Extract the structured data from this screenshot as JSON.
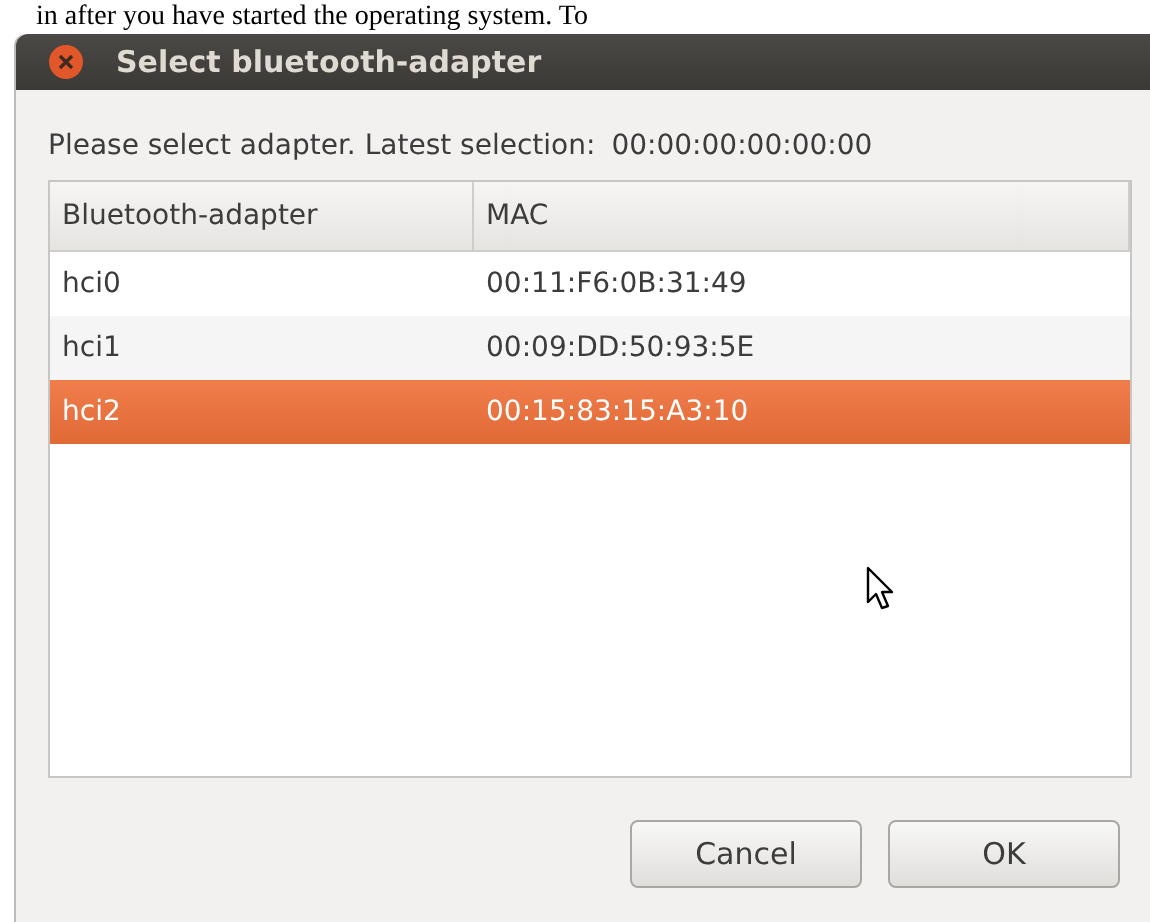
{
  "background_text": "in after you have started the operating system. To",
  "window": {
    "title": "Select bluetooth-adapter"
  },
  "prompt": "Please select adapter. Latest selection:",
  "latest_selection": "00:00:00:00:00:00",
  "table": {
    "columns": [
      "Bluetooth-adapter",
      "MAC"
    ],
    "rows": [
      {
        "cells": [
          "hci0",
          "00:11:F6:0B:31:49"
        ],
        "selected": false
      },
      {
        "cells": [
          "hci1",
          "00:09:DD:50:93:5E"
        ],
        "selected": false
      },
      {
        "cells": [
          "hci2",
          "00:15:83:15:A3:10"
        ],
        "selected": true
      }
    ]
  },
  "buttons": [
    "Cancel",
    "OK"
  ]
}
